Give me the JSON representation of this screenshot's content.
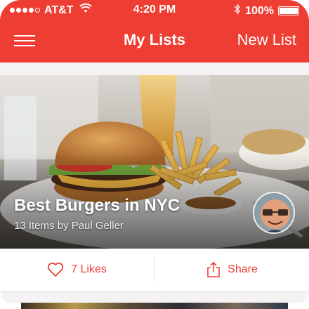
{
  "status_bar": {
    "carrier": "AT&T",
    "time": "4:20 PM",
    "battery": "100%",
    "battery_level": 1.0,
    "signal_bars": 5,
    "signal_bars_filled": 4
  },
  "nav": {
    "title": "My Lists",
    "right_action": "New List",
    "left_icon": "hamburger-menu-icon"
  },
  "card": {
    "title": "Best Burgers in NYC",
    "subtitle": "13 Items by Paul Geller",
    "image": "burger-and-fries-photo",
    "avatar": "user-avatar-photo"
  },
  "actions": {
    "like_label": "7 Likes",
    "like_icon": "heart-icon",
    "share_label": "Share",
    "share_icon": "share-icon"
  },
  "colors": {
    "brand_red": "#ee3d33",
    "background": "#ffffff",
    "strip": "#f4f2f2"
  }
}
